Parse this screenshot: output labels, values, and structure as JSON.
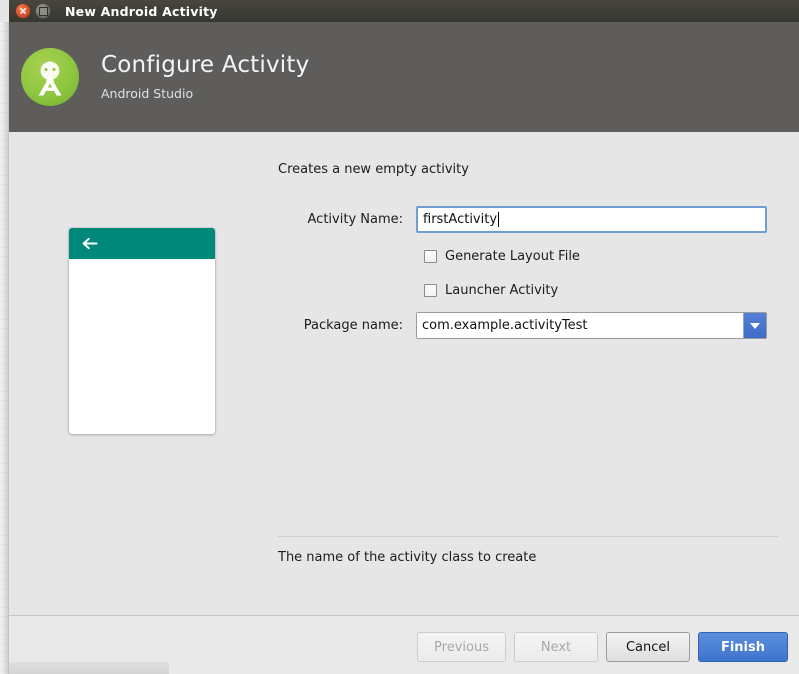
{
  "window": {
    "title": "New Android Activity",
    "close_icon": "close-circle-icon",
    "maximize_icon": "maximize-square-icon"
  },
  "header": {
    "title": "Configure Activity",
    "subtitle": "Android Studio",
    "logo_icon": "android-studio-logo-icon",
    "background_color": "#5e5d5c"
  },
  "preview": {
    "back_icon": "back-arrow-icon",
    "appbar_color": "#00897b",
    "body_color": "#ffffff"
  },
  "form": {
    "description": "Creates a new empty activity",
    "activity_name": {
      "label": "Activity Name:",
      "value": "firstActivity",
      "placeholder": "",
      "focused": true,
      "focus_color": "#6f9fd0"
    },
    "generate_layout_file": {
      "label": "Generate Layout File",
      "checked": false
    },
    "launcher_activity": {
      "label": "Launcher Activity",
      "checked": false
    },
    "package_name": {
      "label": "Package name:",
      "value": "com.example.activityTest",
      "dropdown_icon": "chevron-down-icon",
      "dropdown_color": "#4373cc"
    }
  },
  "help": {
    "text": "The name of the activity class to create"
  },
  "footer": {
    "buttons": [
      {
        "label": "Previous",
        "state": "disabled"
      },
      {
        "label": "Next",
        "state": "disabled"
      },
      {
        "label": "Cancel",
        "state": "normal"
      },
      {
        "label": "Finish",
        "state": "primary"
      }
    ]
  }
}
